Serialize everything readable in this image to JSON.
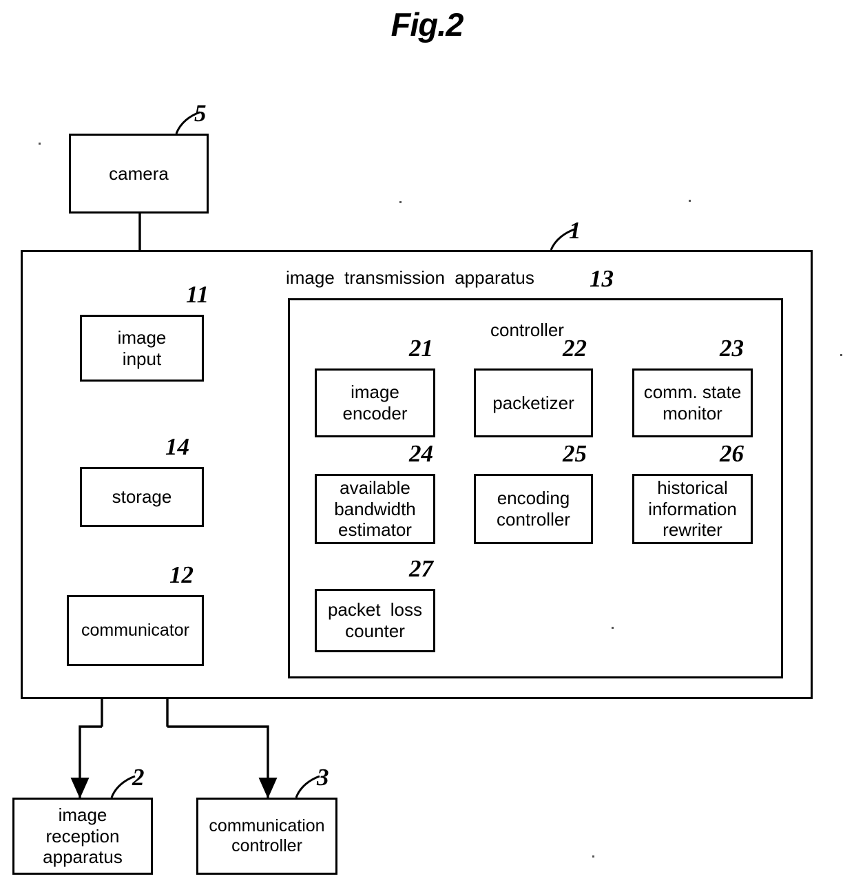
{
  "figure": {
    "title": "Fig.2"
  },
  "boxes": {
    "camera": {
      "label": "camera",
      "ref": "5"
    },
    "apparatus": {
      "label": "image transmission apparatus",
      "ref": "1"
    },
    "image_input": {
      "label": "image\ninput",
      "line1": "image",
      "line2": "input",
      "ref": "11"
    },
    "storage": {
      "label": "storage",
      "ref": "14"
    },
    "communicator": {
      "label": "communicator",
      "ref": "12"
    },
    "controller": {
      "label": "controller",
      "ref": "13"
    },
    "image_encoder": {
      "line1": "image",
      "line2": "encoder",
      "ref": "21"
    },
    "packetizer": {
      "line1": "packetizer",
      "ref": "22"
    },
    "comm_state_monitor": {
      "line1": "comm. state",
      "line2": "monitor",
      "ref": "23"
    },
    "available_bandwidth_estimator": {
      "line1": "available",
      "line2": "bandwidth",
      "line3": "estimator",
      "ref": "24"
    },
    "encoding_controller": {
      "line1": "encoding",
      "line2": "controller",
      "ref": "25"
    },
    "historical_information_rewriter": {
      "line1": "historical",
      "line2": "information",
      "line3": "rewriter",
      "ref": "26"
    },
    "packet_loss_counter": {
      "line1": "packet loss",
      "line2": "counter",
      "ref": "27"
    },
    "image_reception_apparatus": {
      "line1": "image",
      "line2": "reception",
      "line3": "apparatus",
      "ref": "2"
    },
    "communication_controller": {
      "line1": "communication",
      "line2": "controller",
      "ref": "3"
    }
  },
  "colors": {
    "stroke": "#000000",
    "background": "#ffffff"
  }
}
